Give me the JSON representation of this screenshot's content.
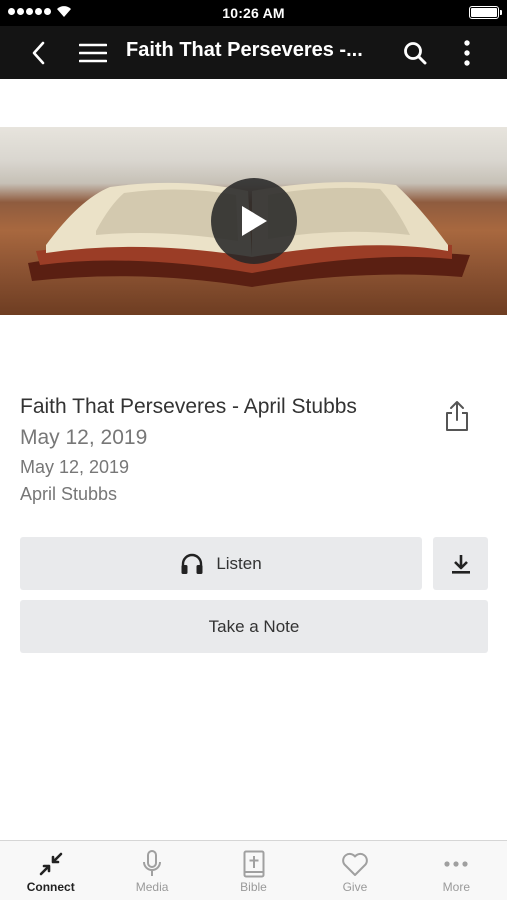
{
  "status_bar": {
    "time": "10:26 AM"
  },
  "nav": {
    "title": "Faith That Perseveres -...",
    "icons": [
      "back-icon",
      "menu-icon",
      "search-icon",
      "more-vertical-icon"
    ]
  },
  "video": {
    "play_icon": "play-icon"
  },
  "sermon": {
    "title": "Faith That Perseveres - April Stubbs",
    "date_primary": "May 12, 2019",
    "date_secondary": "May 12, 2019",
    "speaker": "April Stubbs"
  },
  "actions": {
    "listen_label": "Listen",
    "take_note_label": "Take a Note"
  },
  "tabs": [
    {
      "label": "Connect",
      "icon": "connect-icon",
      "active": true
    },
    {
      "label": "Media",
      "icon": "microphone-icon",
      "active": false
    },
    {
      "label": "Bible",
      "icon": "bible-icon",
      "active": false
    },
    {
      "label": "Give",
      "icon": "heart-icon",
      "active": false
    },
    {
      "label": "More",
      "icon": "more-horizontal-icon",
      "active": false
    }
  ],
  "colors": {
    "nav_background": "#141414",
    "button_background": "#e9eaec",
    "active_tab": "#222222",
    "inactive_tab": "#9a9a9a"
  }
}
